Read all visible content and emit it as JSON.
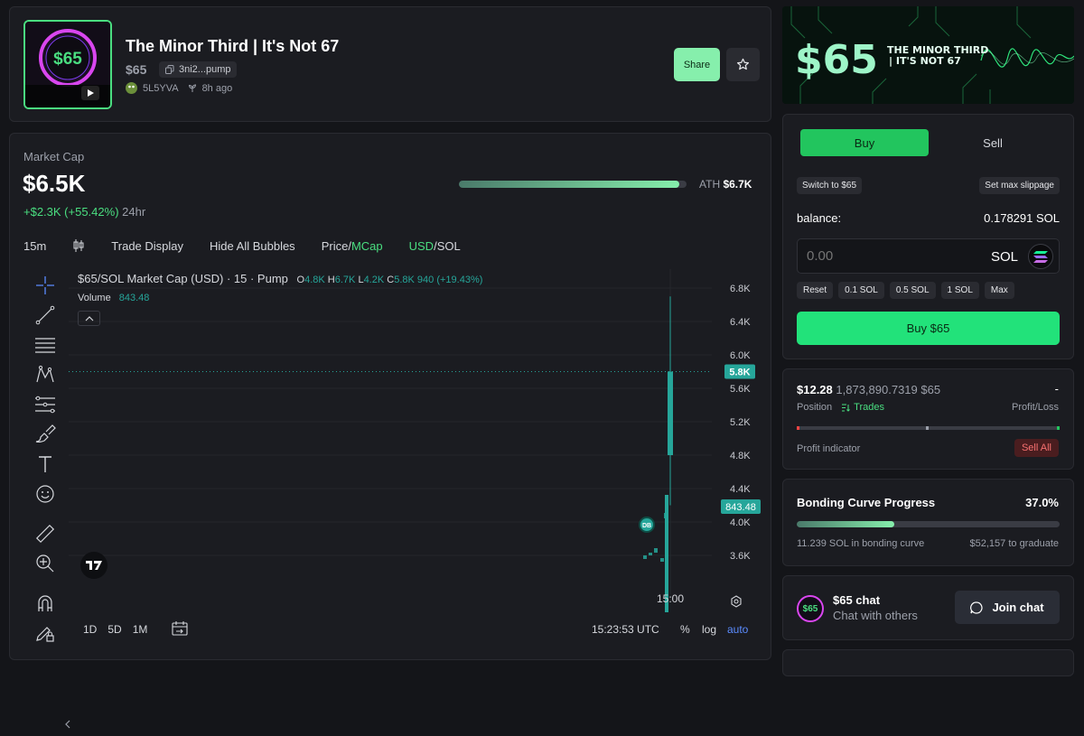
{
  "token": {
    "title": "The Minor Third | It's Not 67",
    "ticker": "$65",
    "contract_short": "3ni2...pump",
    "creator": "5L5YVA",
    "created_ago": "8h ago",
    "thumb_text": "$65",
    "share_label": "Share"
  },
  "market": {
    "label": "Market Cap",
    "value": "$6.5K",
    "change": "+$2.3K (+55.42%)",
    "change_period": "24hr",
    "ath_label": "ATH",
    "ath_value": "$6.7K",
    "ath_progress": 0.97
  },
  "toolbar": {
    "interval": "15m",
    "trade_display": "Trade Display",
    "hide_bubbles": "Hide All Bubbles",
    "price_label": "Price",
    "mcap_label": "MCap",
    "usd_label": "USD",
    "sol_label": "SOL"
  },
  "chart_header": {
    "title": "$65/SOL Market Cap (USD) · 15 · Pump",
    "o_label": "O",
    "o_value": "4.8K",
    "h_label": "H",
    "h_value": "6.7K",
    "l_label": "L",
    "l_value": "4.2K",
    "c_label": "C",
    "c_value": "5.8K",
    "change": "940 (+19.43%)",
    "volume_label": "Volume",
    "volume_value": "843.48"
  },
  "chart_data": {
    "type": "candlestick",
    "title": "$65/SOL Market Cap (USD) · 15 · Pump",
    "y_ticks": [
      "6.8K",
      "6.4K",
      "6.0K",
      "5.6K",
      "5.2K",
      "4.8K",
      "4.4K",
      "4.0K",
      "3.6K"
    ],
    "ylim": [
      3200,
      7000
    ],
    "x_ticks": [
      "15:00"
    ],
    "last_price_label": "5.8K",
    "last_volume_label": "843.48",
    "candles": [
      {
        "time": "15:00",
        "open": 4800,
        "high": 6700,
        "low": 4200,
        "close": 5800
      }
    ],
    "dev_badge": "DB",
    "grid": true
  },
  "bottom_bar": {
    "ranges": [
      "1D",
      "5D",
      "1M"
    ],
    "time": "15:23:53 UTC",
    "percent": "%",
    "log": "log",
    "auto": "auto"
  },
  "banner": {
    "big": "$65",
    "line1": "THE MINOR THIRD",
    "line2": "| IT'S NOT 67"
  },
  "trade": {
    "buy_tab": "Buy",
    "sell_tab": "Sell",
    "switch_label": "Switch to $65",
    "slippage_label": "Set max slippage",
    "balance_label": "balance:",
    "balance_value": "0.178291 SOL",
    "amount_placeholder": "0.00",
    "amount_unit": "SOL",
    "quick": [
      "Reset",
      "0.1 SOL",
      "0.5 SOL",
      "1 SOL",
      "Max"
    ],
    "buy_button": "Buy $65"
  },
  "position": {
    "value_usd": "$12.28",
    "amount": "1,873,890.7319 $65",
    "pl_value": "-",
    "position_label": "Position",
    "trades_label": "Trades",
    "pl_label": "Profit/Loss",
    "indicator_label": "Profit indicator",
    "sell_all": "Sell All"
  },
  "bonding": {
    "title": "Bonding Curve Progress",
    "percent": "37.0%",
    "progress": 0.37,
    "in_curve": "11.239 SOL in bonding curve",
    "to_graduate": "$52,157 to graduate"
  },
  "chat": {
    "logo_text": "$65",
    "title": "$65 chat",
    "subtitle": "Chat with others",
    "join": "Join chat"
  },
  "colors": {
    "accent": "#22e27a",
    "up": "#26a69a",
    "sell": "#f87171"
  }
}
